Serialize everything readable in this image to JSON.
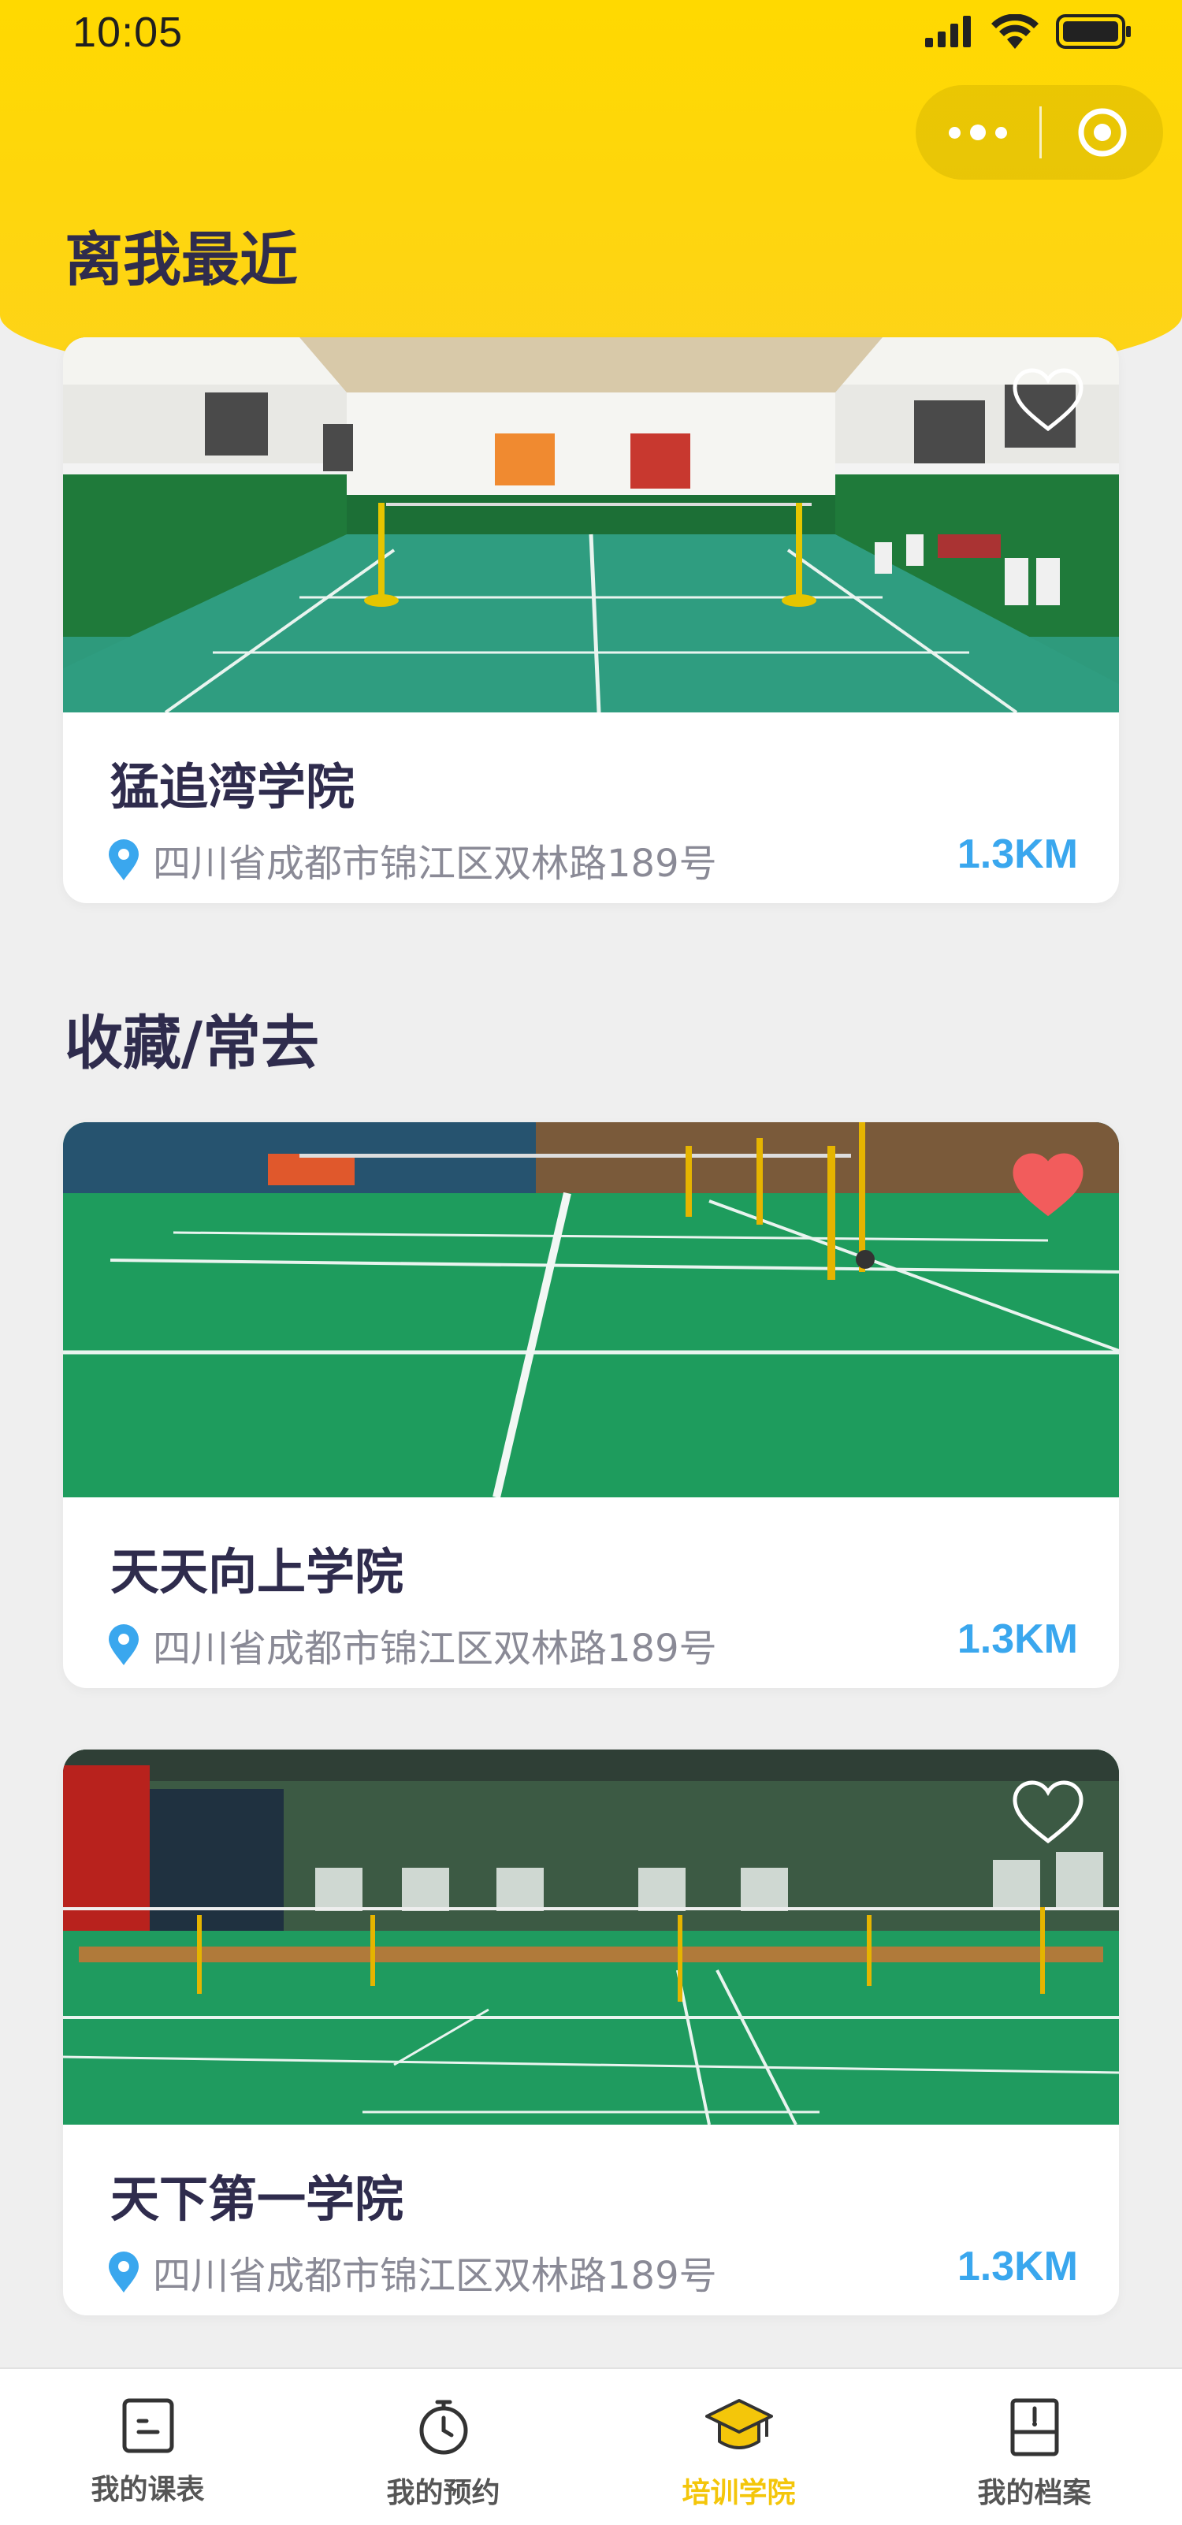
{
  "status_bar": {
    "time": "10:05"
  },
  "sections": {
    "nearest_title": "离我最近",
    "favorites_title": "收藏/常去"
  },
  "cards": [
    {
      "name": "猛追湾学院",
      "address": "四川省成都市锦江区双林路189号",
      "distance": "1.3KM",
      "favorited": false
    },
    {
      "name": "天天向上学院",
      "address": "四川省成都市锦江区双林路189号",
      "distance": "1.3KM",
      "favorited": true
    },
    {
      "name": "天下第一学院",
      "address": "四川省成都市锦江区双林路189号",
      "distance": "1.3KM",
      "favorited": false
    }
  ],
  "tabbar": [
    {
      "label": "我的课表",
      "icon": "schedule-icon",
      "active": false
    },
    {
      "label": "我的预约",
      "icon": "stopwatch-icon",
      "active": false
    },
    {
      "label": "培训学院",
      "icon": "graduation-cap-icon",
      "active": true
    },
    {
      "label": "我的档案",
      "icon": "archive-icon",
      "active": false
    }
  ],
  "colors": {
    "header_yellow": "#ffd900",
    "accent_blue": "#3aa7ee",
    "heart_red": "#f25c5c",
    "active_tab": "#f4c60a"
  }
}
